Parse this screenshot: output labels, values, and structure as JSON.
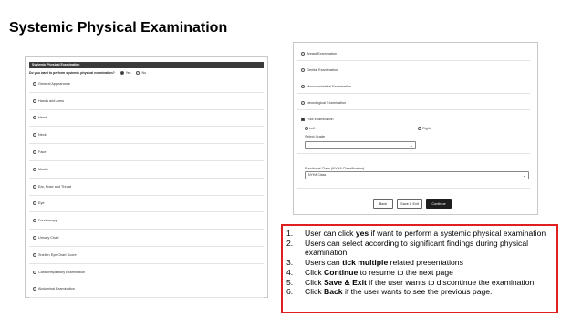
{
  "slide_title": "Systemic Physical Examination",
  "left_form": {
    "header": "Systemic Physical Examination",
    "question": "Do you want to perform systemic physical examination?",
    "yes_label": "Yes",
    "no_label": "No",
    "selected": "Yes",
    "items": [
      "General Appearance",
      "Hands and Arms",
      "Head",
      "Neck",
      "Face",
      "Mouth",
      "Ear, Nose and Throat",
      "Eye",
      "Fundoscopy",
      "Urinary Chart",
      "Snellen Eye Chart Score",
      "Cardiorespiratory Examination",
      "Abdominal Examination"
    ]
  },
  "right_form": {
    "items": [
      "Breast Examination",
      "Genital Examination",
      "Musculoskeletal Examination",
      "Neurological Examination"
    ],
    "foot_exam": {
      "label": "Foot Examination",
      "checked": true,
      "left_label": "Left",
      "right_label": "Right",
      "grade_label": "Select Grade"
    },
    "functional_class": {
      "label": "Functional Class (NYHA Classification)",
      "value": "NYHA Class I"
    },
    "buttons": {
      "back": "Back",
      "save_exit": "Save & Exit",
      "continue": "Continue"
    }
  },
  "instructions": {
    "items": [
      {
        "num": "1.",
        "pre": "User can click ",
        "bold": "yes",
        "post": " if want to perform a systemic physical examination"
      },
      {
        "num": "2.",
        "pre": "Users can select according to significant findings during physical examination.",
        "bold": "",
        "post": ""
      },
      {
        "num": "3.",
        "pre": "Users can ",
        "bold": "tick multiple",
        "post": " related presentations"
      },
      {
        "num": "4.",
        "pre": "Click ",
        "bold": "Continue",
        "post": " to resume to the next page"
      },
      {
        "num": "5.",
        "pre": "Click ",
        "bold": "Save & Exit",
        "post": " if the user wants to discontinue the examination"
      },
      {
        "num": "6.",
        "pre": "Click ",
        "bold": "Back",
        "post": " if the user wants to see the previous page."
      }
    ]
  }
}
